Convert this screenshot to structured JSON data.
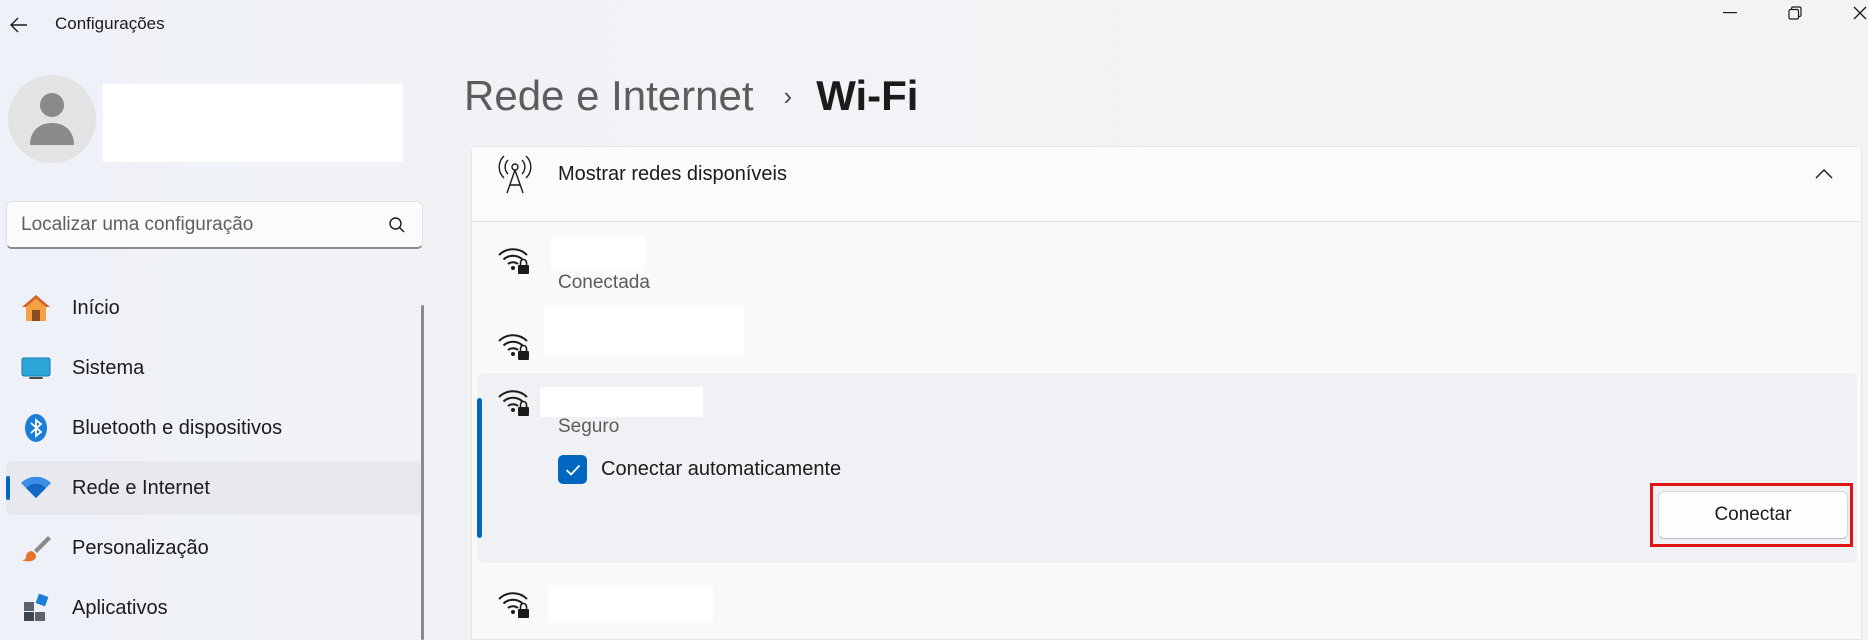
{
  "titlebar": {
    "app_title": "Configurações",
    "icons": {
      "back": "back-arrow-icon",
      "minimize": "minimize-icon",
      "restore": "restore-icon",
      "close": "close-icon"
    }
  },
  "sidebar": {
    "search": {
      "placeholder": "Localizar uma configuração",
      "icon": "search-icon"
    },
    "items": [
      {
        "label": "Início",
        "icon": "home-icon",
        "active": false
      },
      {
        "label": "Sistema",
        "icon": "monitor-icon",
        "active": false
      },
      {
        "label": "Bluetooth e dispositivos",
        "icon": "bluetooth-icon",
        "active": false
      },
      {
        "label": "Rede e Internet",
        "icon": "wifi-icon",
        "active": true
      },
      {
        "label": "Personalização",
        "icon": "brush-icon",
        "active": false
      },
      {
        "label": "Aplicativos",
        "icon": "apps-icon",
        "active": false
      }
    ]
  },
  "header": {
    "parent": "Rede e Internet",
    "separator": "›",
    "current": "Wi-Fi"
  },
  "networks_panel": {
    "title": "Mostrar redes disponíveis",
    "networks": [
      {
        "status": "Conectada"
      },
      {
        "status": ""
      },
      {
        "status": "Seguro",
        "expanded": true,
        "auto_connect_label": "Conectar automaticamente",
        "auto_connect_checked": true,
        "connect_label": "Conectar"
      },
      {
        "status": ""
      }
    ]
  },
  "colors": {
    "accent": "#0067c0",
    "highlight": "#e01515"
  }
}
